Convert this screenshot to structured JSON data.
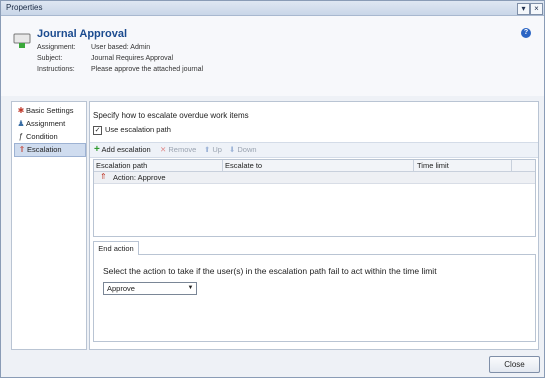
{
  "window": {
    "title": "Properties",
    "menu_glyph": "▾",
    "close_glyph": "×"
  },
  "header": {
    "title": "Journal Approval",
    "assignment_key": "Assignment:",
    "assignment_val": "User based: Admin",
    "subject_key": "Subject:",
    "subject_val": "Journal Requires Approval",
    "instructions_key": "Instructions:",
    "instructions_val": "Please approve the attached journal",
    "help_glyph": "?"
  },
  "nav": {
    "items": [
      {
        "label": "Basic Settings",
        "icon": "star-icon",
        "glyph": "✱",
        "color": "#c0392b"
      },
      {
        "label": "Assignment",
        "icon": "users-icon",
        "glyph": "♟",
        "color": "#3a6ea5"
      },
      {
        "label": "Condition",
        "icon": "function-icon",
        "glyph": "ƒ",
        "color": "#333333"
      },
      {
        "label": "Escalation",
        "icon": "escalation-icon",
        "glyph": "⇑",
        "color": "#c0392b"
      }
    ],
    "selected": "Escalation"
  },
  "escalation": {
    "description": "Specify how to escalate overdue work items",
    "use_path_label": "Use escalation path",
    "use_path_checked": "✓",
    "toolbar": {
      "add": "Add escalation",
      "remove": "Remove",
      "up": "Up",
      "down": "Down"
    },
    "columns": [
      "Escalation path",
      "Escalate to",
      "Time limit"
    ],
    "rows": [
      {
        "path": "Action: Approve",
        "escalate_to": "",
        "time_limit": ""
      }
    ]
  },
  "end_action": {
    "tab_label": "End action",
    "prompt": "Select the action to take if the user(s) in the escalation path fail to act within the time limit",
    "selected": "Approve"
  },
  "footer": {
    "close_label": "Close"
  },
  "colors": {
    "title_blue": "#1b4b8f",
    "accent_green": "#2e9a2e",
    "remove_red": "#d04040"
  }
}
